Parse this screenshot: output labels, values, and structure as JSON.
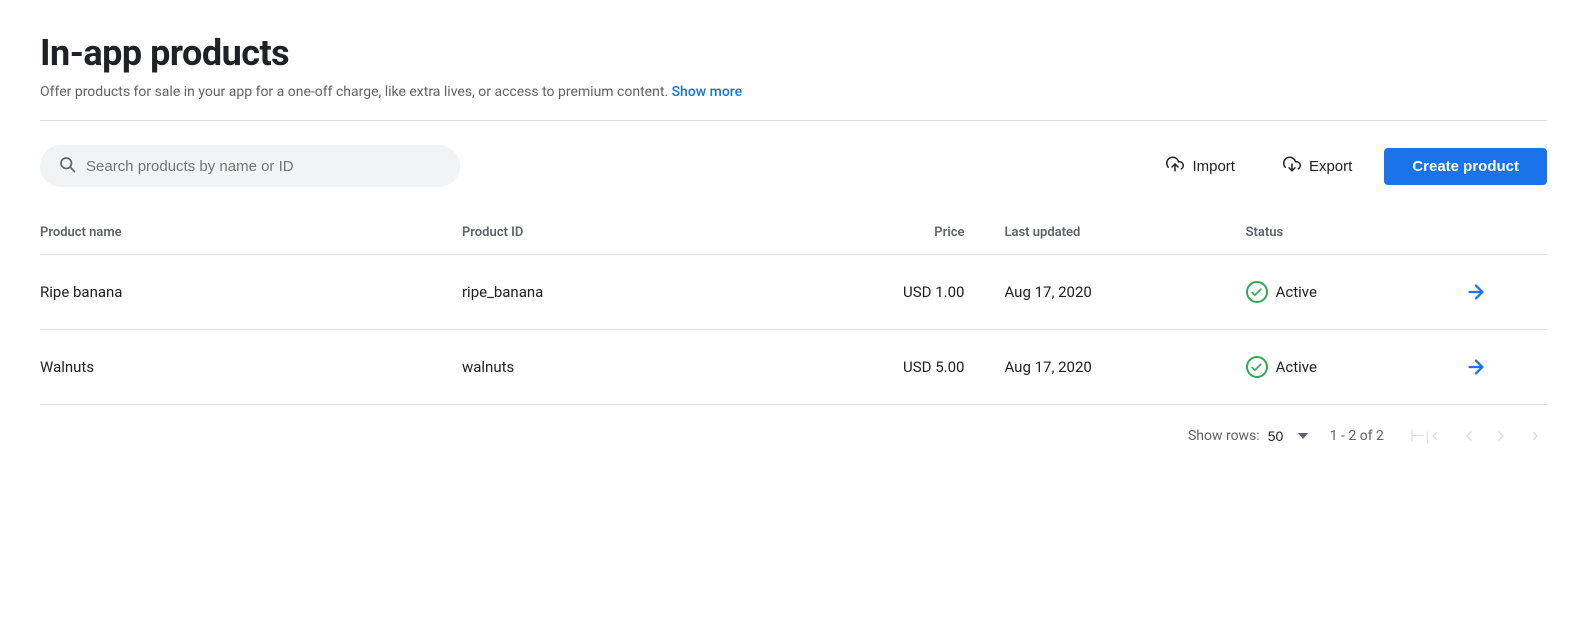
{
  "page": {
    "title": "In-app products",
    "subtitle": "Offer products for sale in your app for a one-off charge, like extra lives, or access to premium content.",
    "show_more_label": "Show more"
  },
  "toolbar": {
    "search_placeholder": "Search products by name or ID",
    "import_label": "Import",
    "export_label": "Export",
    "create_label": "Create product"
  },
  "table": {
    "columns": [
      {
        "key": "name",
        "label": "Product name"
      },
      {
        "key": "id",
        "label": "Product ID"
      },
      {
        "key": "price",
        "label": "Price"
      },
      {
        "key": "updated",
        "label": "Last updated"
      },
      {
        "key": "status",
        "label": "Status"
      }
    ],
    "rows": [
      {
        "name": "Ripe banana",
        "product_id": "ripe_banana",
        "price": "USD 1.00",
        "last_updated": "Aug 17, 2020",
        "status": "Active"
      },
      {
        "name": "Walnuts",
        "product_id": "walnuts",
        "price": "USD 5.00",
        "last_updated": "Aug 17, 2020",
        "status": "Active"
      }
    ]
  },
  "pagination": {
    "show_rows_label": "Show rows:",
    "rows_value": "50",
    "page_info": "1 - 2 of 2"
  },
  "colors": {
    "primary": "#1a73e8",
    "active_green": "#34a853"
  }
}
